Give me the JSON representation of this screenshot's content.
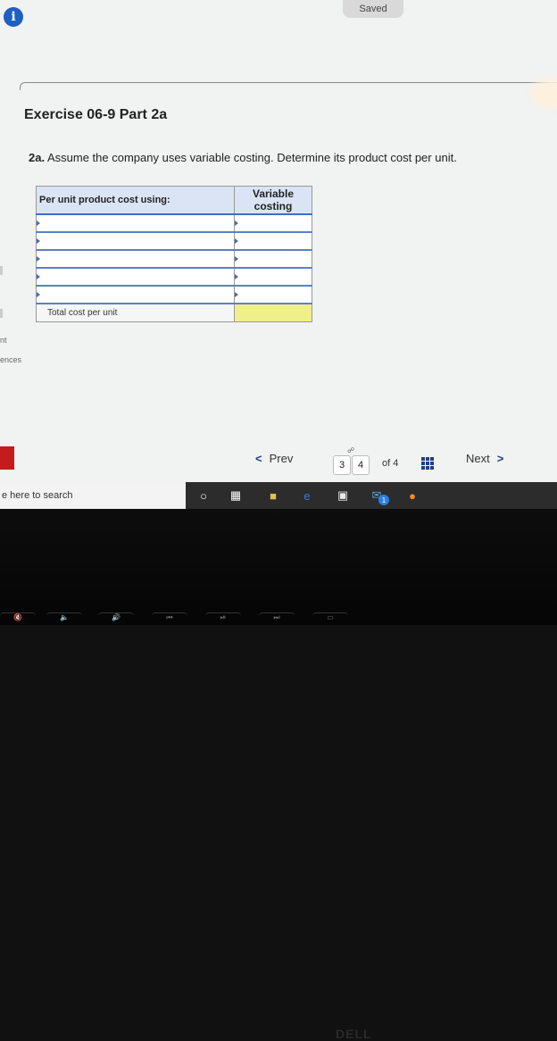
{
  "status": {
    "saved": "Saved"
  },
  "exercise": {
    "title": "Exercise 06-9 Part 2a",
    "question_label": "2a.",
    "question_text": " Assume the company uses variable costing. Determine its product cost per unit."
  },
  "table": {
    "header_label": "Per unit product cost using:",
    "header_col": "Variable costing",
    "rows": 5,
    "total_label": "Total cost per unit"
  },
  "side": {
    "frag1": "nt",
    "frag2": "ences"
  },
  "navigation": {
    "prev_label": "Prev",
    "page_current": "3",
    "page_next": "4",
    "page_of": "of 4",
    "next_label": "Next"
  },
  "taskbar": {
    "search_placeholder": "e here to search",
    "mail_badge": "1"
  },
  "keyboard": {
    "brand": "DELL"
  }
}
